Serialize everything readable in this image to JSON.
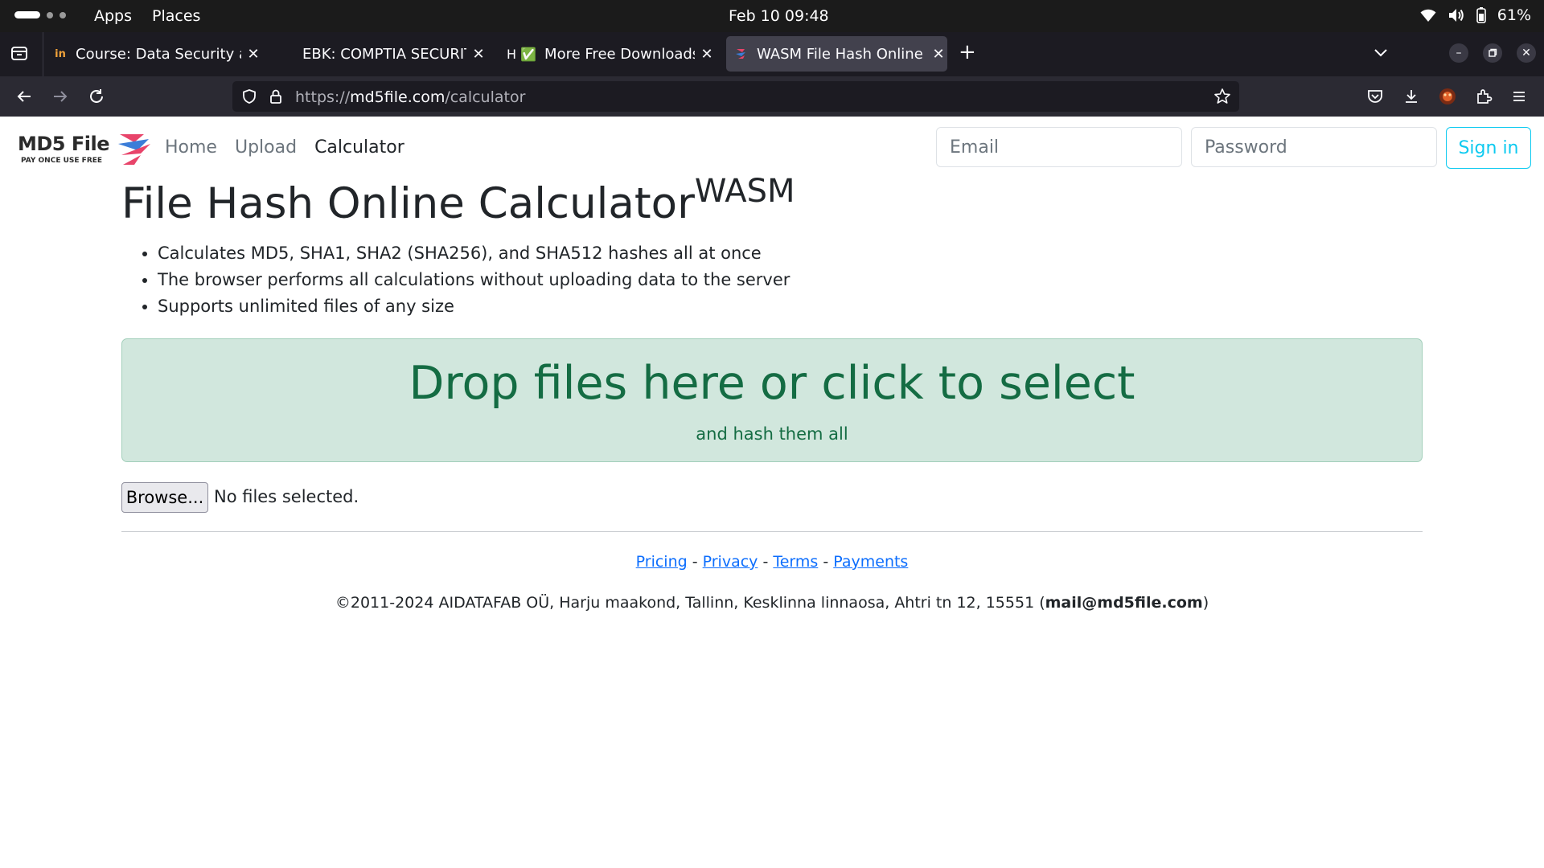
{
  "system_bar": {
    "apps_label": "Apps",
    "places_label": "Places",
    "datetime": "Feb 10  09:48",
    "battery": "61%"
  },
  "tabs": [
    {
      "favicon_text": "in",
      "title": "Course: Data Security and",
      "active": false
    },
    {
      "favicon_text": "",
      "title": "EBK: COMPTIA SECURITY+",
      "active": false
    },
    {
      "favicon_text": "H ✅",
      "title": "More Free Downloads",
      "active": false
    },
    {
      "favicon_text": "",
      "title": "WASM File Hash Online Ca",
      "active": true
    }
  ],
  "toolbar": {
    "url_prefix": "https://",
    "url_domain": "md5file.com",
    "url_path": "/calculator"
  },
  "site": {
    "logo_text": "MD5 File",
    "logo_tagline": "PAY ONCE USE FREE",
    "nav": [
      "Home",
      "Upload",
      "Calculator"
    ],
    "email_placeholder": "Email",
    "password_placeholder": "Password",
    "signin_label": "Sign in"
  },
  "content": {
    "title": "File Hash Online Calculator",
    "title_sup": "WASM",
    "bullets": [
      "Calculates MD5, SHA1, SHA2 (SHA256), and SHA512 hashes all at once",
      "The browser performs all calculations without uploading data to the server",
      "Supports unlimited files of any size"
    ],
    "dropzone_title": "Drop files here or click to select",
    "dropzone_subtitle": "and hash them all",
    "browse_label": "Browse...",
    "no_files_label": "No files selected."
  },
  "footer": {
    "links": [
      "Pricing",
      "Privacy",
      "Terms",
      "Payments"
    ],
    "copyright": "©2011-2024 AIDATAFAB OÜ, Harju maakond, Tallinn, Kesklinna linnaosa, Ahtri tn 12, 15551 (",
    "email": "mail@md5file.com",
    "copyright_end": ")"
  },
  "colors": {
    "dropzone_bg": "#d1e7dd",
    "dropzone_text": "#146c43",
    "link": "#0d6efd",
    "signin": "#0dcaf0"
  }
}
